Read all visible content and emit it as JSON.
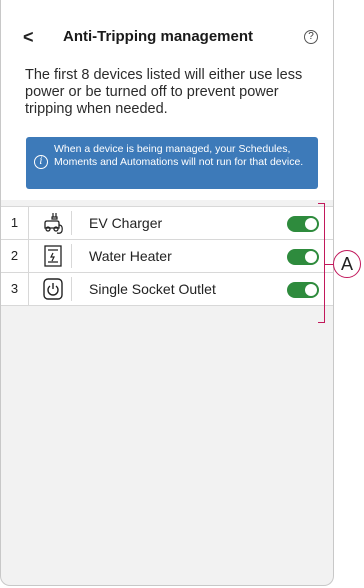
{
  "header": {
    "back_glyph": "<",
    "title": "Anti-Tripping  management",
    "help_glyph": "?"
  },
  "description": "The first 8 devices listed will either use less power or be turned off to prevent power tripping when needed.",
  "banner": {
    "icon_glyph": "i",
    "text": "When a device is being managed, your Schedules, Moments and Automations will not run for that device."
  },
  "devices": [
    {
      "index": "1",
      "icon": "ev-charger-icon",
      "label": "EV Charger",
      "enabled": true
    },
    {
      "index": "2",
      "icon": "water-heater-icon",
      "label": "Water Heater",
      "enabled": true
    },
    {
      "index": "3",
      "icon": "power-outlet-icon",
      "label": "Single Socket Outlet",
      "enabled": true
    }
  ],
  "callout": {
    "label": "A",
    "color": "#c2185b"
  },
  "colors": {
    "accent": "#3d7ab9",
    "toggle_on": "#2e8b3d"
  }
}
